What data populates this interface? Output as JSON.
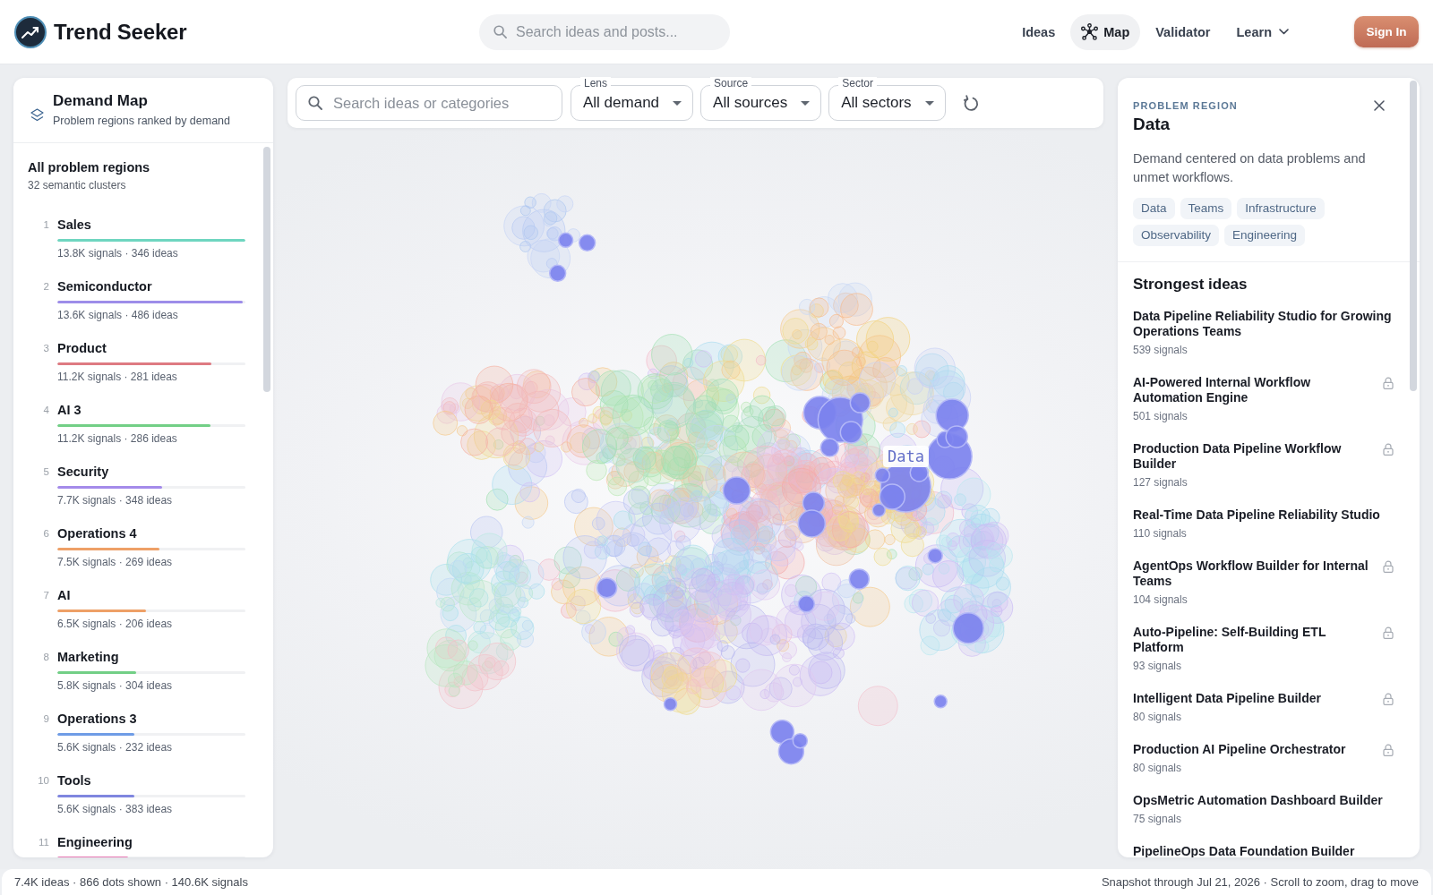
{
  "header": {
    "brand": "Trend Seeker",
    "search": {
      "placeholder": "Search ideas and posts..."
    },
    "nav": [
      {
        "label": "Ideas",
        "kind": "plain",
        "selected": false
      },
      {
        "label": "Map",
        "kind": "icon",
        "selected": true
      },
      {
        "label": "Validator",
        "kind": "plain",
        "selected": false
      },
      {
        "label": "Learn",
        "kind": "dropdown",
        "selected": false
      }
    ],
    "sign_in": "Sign In"
  },
  "sidebar": {
    "title": "Demand Map",
    "subtitle": "Problem regions ranked by demand",
    "all_regions": {
      "title": "All problem regions",
      "count": "32 semantic clusters"
    },
    "regions": [
      {
        "rank": "1",
        "name": "Sales",
        "level": 1.0,
        "color": "#6fd6c0",
        "stats": "13.8K signals · 346 ideas"
      },
      {
        "rank": "2",
        "name": "Semiconductor",
        "level": 0.986,
        "color": "#9d8de9",
        "stats": "13.6K signals · 486 ideas"
      },
      {
        "rank": "3",
        "name": "Product",
        "level": 0.817,
        "color": "#de7a82",
        "stats": "11.2K signals · 281 ideas"
      },
      {
        "rank": "4",
        "name": "AI 3",
        "level": 0.814,
        "color": "#72cf86",
        "stats": "11.2K signals · 286 ideas"
      },
      {
        "rank": "5",
        "name": "Security",
        "level": 0.557,
        "color": "#a48bea",
        "stats": "7.7K signals · 348 ideas"
      },
      {
        "rank": "6",
        "name": "Operations 4",
        "level": 0.543,
        "color": "#eea067",
        "stats": "7.5K signals · 269 ideas"
      },
      {
        "rank": "7",
        "name": "AI",
        "level": 0.47,
        "color": "#eea067",
        "stats": "6.5K signals · 206 ideas"
      },
      {
        "rank": "8",
        "name": "Marketing",
        "level": 0.42,
        "color": "#72cf86",
        "stats": "5.8K signals · 304 ideas"
      },
      {
        "rank": "9",
        "name": "Operations 3",
        "level": 0.41,
        "color": "#6f9ce6",
        "stats": "5.6K signals · 232 ideas"
      },
      {
        "rank": "10",
        "name": "Tools",
        "level": 0.41,
        "color": "#7f86df",
        "stats": "5.6K signals · 383 ideas"
      },
      {
        "rank": "11",
        "name": "Engineering",
        "level": 0.376,
        "color": "#e777b3"
      }
    ]
  },
  "filters": {
    "search": {
      "placeholder": "Search ideas or categories"
    },
    "selects": [
      {
        "label": "Lens",
        "value": "All demand"
      },
      {
        "label": "Source",
        "value": "All sources"
      },
      {
        "label": "Sector",
        "value": "All sectors"
      }
    ]
  },
  "map": {
    "label": "Data"
  },
  "detail": {
    "eyebrow": "PROBLEM REGION",
    "title": "Data",
    "description": "Demand centered on data problems and unmet workflows.",
    "tags": [
      "Data",
      "Teams",
      "Infrastructure",
      "Observability",
      "Engineering"
    ],
    "section_title": "Strongest ideas",
    "ideas": [
      {
        "title": "Data Pipeline Reliability Studio for Growing Operations Teams",
        "signals": "539 signals",
        "locked": false
      },
      {
        "title": "AI-Powered Internal Workflow Automation Engine",
        "signals": "501 signals",
        "locked": true
      },
      {
        "title": "Production Data Pipeline Workflow Builder",
        "signals": "127 signals",
        "locked": true
      },
      {
        "title": "Real-Time Data Pipeline Reliability Studio",
        "signals": "110 signals",
        "locked": false
      },
      {
        "title": "AgentOps Workflow Builder for Internal Teams",
        "signals": "104 signals",
        "locked": true
      },
      {
        "title": "Auto-Pipeline: Self-Building ETL Platform",
        "signals": "93 signals",
        "locked": true
      },
      {
        "title": "Intelligent Data Pipeline Builder",
        "signals": "80 signals",
        "locked": true
      },
      {
        "title": "Production AI Pipeline Orchestrator",
        "signals": "80 signals",
        "locked": true
      },
      {
        "title": "OpsMetric Automation Dashboard Builder",
        "signals": "75 signals",
        "locked": false
      },
      {
        "title": "PipelineOps Data Foundation Builder",
        "locked": false
      }
    ]
  },
  "status_bar": {
    "left": "7.4K ideas · 866 dots shown · 140.6K signals",
    "right": "Snapshot through Jul 21, 2026 · Scroll to zoom, drag to move"
  }
}
